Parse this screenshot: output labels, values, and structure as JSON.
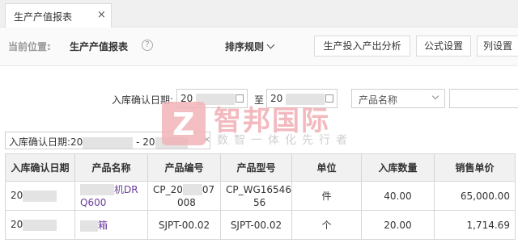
{
  "tab": {
    "label": "生产产值报表",
    "close": "×"
  },
  "header": {
    "crumb_prefix": "当前位置:",
    "crumb_title": "生产产值报表",
    "help": "?",
    "sort_label": "排序规则",
    "buttons": [
      "生产投入产出分析",
      "公式设置",
      "列设置"
    ]
  },
  "filters": {
    "date_label": "入库确认日期:",
    "date_from": "20",
    "to_label": "至",
    "date_to": "20",
    "product_placeholder": "产品名称"
  },
  "chip": {
    "text_start": "入库确认日期:20",
    "text_mid": "- 20",
    "close": "×"
  },
  "watermark": {
    "logo_char": "Z",
    "title": "智邦国际",
    "subtitle": "数智一体化先行者"
  },
  "table": {
    "headers": [
      "入库确认日期",
      "产品名称",
      "产品编号",
      "产品型号",
      "单位",
      "入库数量",
      "销售单价"
    ],
    "rows": [
      {
        "date": "20",
        "name_line1": "机DR",
        "name_line2": "Q600",
        "code_line1": "CP_20",
        "code_line1b": "07",
        "code_line2": "008",
        "model_line1": "CP_WG16546",
        "model_line2": "56",
        "unit": "件",
        "qty": "40.00",
        "price": "65,000.00"
      },
      {
        "date": "20",
        "name": "箱",
        "code": "SJPT-00.02",
        "model": "SJPT-00.02",
        "unit": "个",
        "qty": "20.00",
        "price": "1,714.69"
      }
    ]
  }
}
